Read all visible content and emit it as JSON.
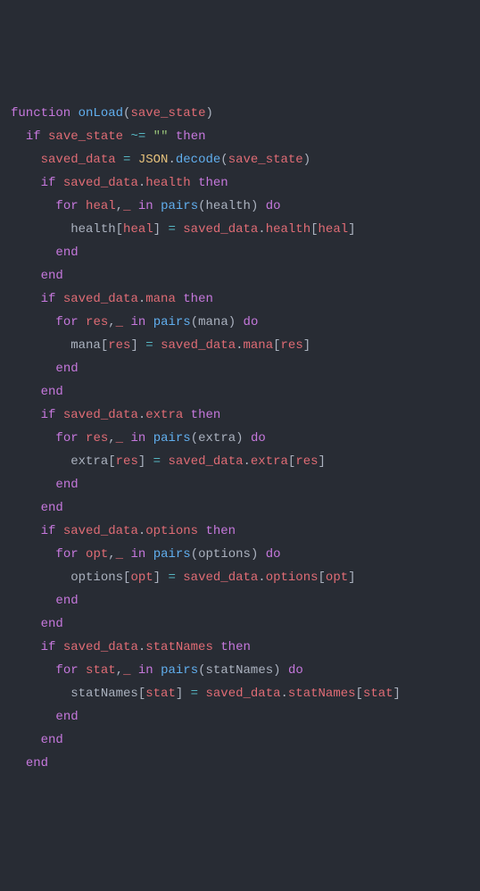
{
  "code": {
    "lines": [
      {
        "indent": 0,
        "tokens": [
          [
            "kw",
            "function"
          ],
          [
            "plain",
            " "
          ],
          [
            "fn",
            "onLoad"
          ],
          [
            "plain",
            "("
          ],
          [
            "id",
            "save_state"
          ],
          [
            "plain",
            ")"
          ]
        ]
      },
      {
        "indent": 1,
        "tokens": [
          [
            "kw",
            "if"
          ],
          [
            "plain",
            " "
          ],
          [
            "id",
            "save_state"
          ],
          [
            "plain",
            " "
          ],
          [
            "op",
            "~="
          ],
          [
            "plain",
            " "
          ],
          [
            "str",
            "\"\""
          ],
          [
            "plain",
            " "
          ],
          [
            "kw",
            "then"
          ]
        ]
      },
      {
        "indent": 2,
        "tokens": [
          [
            "id",
            "saved_data"
          ],
          [
            "plain",
            " "
          ],
          [
            "op",
            "="
          ],
          [
            "plain",
            " "
          ],
          [
            "cls",
            "JSON"
          ],
          [
            "plain",
            "."
          ],
          [
            "meth",
            "decode"
          ],
          [
            "plain",
            "("
          ],
          [
            "id",
            "save_state"
          ],
          [
            "plain",
            ")"
          ]
        ]
      },
      {
        "indent": 2,
        "tokens": [
          [
            "kw",
            "if"
          ],
          [
            "plain",
            " "
          ],
          [
            "id",
            "saved_data"
          ],
          [
            "plain",
            "."
          ],
          [
            "prop",
            "health"
          ],
          [
            "plain",
            " "
          ],
          [
            "kw",
            "then"
          ]
        ]
      },
      {
        "indent": 3,
        "tokens": [
          [
            "kw",
            "for"
          ],
          [
            "plain",
            " "
          ],
          [
            "id",
            "heal"
          ],
          [
            "plain",
            ","
          ],
          [
            "id",
            "_"
          ],
          [
            "plain",
            " "
          ],
          [
            "kw",
            "in"
          ],
          [
            "plain",
            " "
          ],
          [
            "fn",
            "pairs"
          ],
          [
            "plain",
            "("
          ],
          [
            "plain",
            "health"
          ],
          [
            "plain",
            ") "
          ],
          [
            "kw",
            "do"
          ]
        ]
      },
      {
        "indent": 4,
        "tokens": [
          [
            "plain",
            "health"
          ],
          [
            "plain",
            "["
          ],
          [
            "id",
            "heal"
          ],
          [
            "plain",
            "] "
          ],
          [
            "op",
            "="
          ],
          [
            "plain",
            " "
          ],
          [
            "id",
            "saved_data"
          ],
          [
            "plain",
            "."
          ],
          [
            "prop",
            "health"
          ],
          [
            "plain",
            "["
          ],
          [
            "id",
            "heal"
          ],
          [
            "plain",
            "]"
          ]
        ]
      },
      {
        "indent": 3,
        "tokens": [
          [
            "kw",
            "end"
          ]
        ]
      },
      {
        "indent": 2,
        "tokens": [
          [
            "kw",
            "end"
          ]
        ]
      },
      {
        "indent": 2,
        "tokens": [
          [
            "kw",
            "if"
          ],
          [
            "plain",
            " "
          ],
          [
            "id",
            "saved_data"
          ],
          [
            "plain",
            "."
          ],
          [
            "prop",
            "mana"
          ],
          [
            "plain",
            " "
          ],
          [
            "kw",
            "then"
          ]
        ]
      },
      {
        "indent": 3,
        "tokens": [
          [
            "kw",
            "for"
          ],
          [
            "plain",
            " "
          ],
          [
            "id",
            "res"
          ],
          [
            "plain",
            ","
          ],
          [
            "id",
            "_"
          ],
          [
            "plain",
            " "
          ],
          [
            "kw",
            "in"
          ],
          [
            "plain",
            " "
          ],
          [
            "fn",
            "pairs"
          ],
          [
            "plain",
            "("
          ],
          [
            "plain",
            "mana"
          ],
          [
            "plain",
            ") "
          ],
          [
            "kw",
            "do"
          ]
        ]
      },
      {
        "indent": 4,
        "tokens": [
          [
            "plain",
            "mana"
          ],
          [
            "plain",
            "["
          ],
          [
            "id",
            "res"
          ],
          [
            "plain",
            "] "
          ],
          [
            "op",
            "="
          ],
          [
            "plain",
            " "
          ],
          [
            "id",
            "saved_data"
          ],
          [
            "plain",
            "."
          ],
          [
            "prop",
            "mana"
          ],
          [
            "plain",
            "["
          ],
          [
            "id",
            "res"
          ],
          [
            "plain",
            "]"
          ]
        ]
      },
      {
        "indent": 3,
        "tokens": [
          [
            "kw",
            "end"
          ]
        ]
      },
      {
        "indent": 2,
        "tokens": [
          [
            "kw",
            "end"
          ]
        ]
      },
      {
        "indent": 2,
        "tokens": [
          [
            "kw",
            "if"
          ],
          [
            "plain",
            " "
          ],
          [
            "id",
            "saved_data"
          ],
          [
            "plain",
            "."
          ],
          [
            "prop",
            "extra"
          ],
          [
            "plain",
            " "
          ],
          [
            "kw",
            "then"
          ]
        ]
      },
      {
        "indent": 3,
        "tokens": [
          [
            "kw",
            "for"
          ],
          [
            "plain",
            " "
          ],
          [
            "id",
            "res"
          ],
          [
            "plain",
            ","
          ],
          [
            "id",
            "_"
          ],
          [
            "plain",
            " "
          ],
          [
            "kw",
            "in"
          ],
          [
            "plain",
            " "
          ],
          [
            "fn",
            "pairs"
          ],
          [
            "plain",
            "("
          ],
          [
            "plain",
            "extra"
          ],
          [
            "plain",
            ") "
          ],
          [
            "kw",
            "do"
          ]
        ]
      },
      {
        "indent": 4,
        "tokens": [
          [
            "plain",
            "extra"
          ],
          [
            "plain",
            "["
          ],
          [
            "id",
            "res"
          ],
          [
            "plain",
            "] "
          ],
          [
            "op",
            "="
          ],
          [
            "plain",
            " "
          ],
          [
            "id",
            "saved_data"
          ],
          [
            "plain",
            "."
          ],
          [
            "prop",
            "extra"
          ],
          [
            "plain",
            "["
          ],
          [
            "id",
            "res"
          ],
          [
            "plain",
            "]"
          ]
        ]
      },
      {
        "indent": 3,
        "tokens": [
          [
            "kw",
            "end"
          ]
        ]
      },
      {
        "indent": 2,
        "tokens": [
          [
            "kw",
            "end"
          ]
        ]
      },
      {
        "indent": 2,
        "tokens": [
          [
            "kw",
            "if"
          ],
          [
            "plain",
            " "
          ],
          [
            "id",
            "saved_data"
          ],
          [
            "plain",
            "."
          ],
          [
            "prop",
            "options"
          ],
          [
            "plain",
            " "
          ],
          [
            "kw",
            "then"
          ]
        ]
      },
      {
        "indent": 3,
        "tokens": [
          [
            "kw",
            "for"
          ],
          [
            "plain",
            " "
          ],
          [
            "id",
            "opt"
          ],
          [
            "plain",
            ","
          ],
          [
            "id",
            "_"
          ],
          [
            "plain",
            " "
          ],
          [
            "kw",
            "in"
          ],
          [
            "plain",
            " "
          ],
          [
            "fn",
            "pairs"
          ],
          [
            "plain",
            "("
          ],
          [
            "plain",
            "options"
          ],
          [
            "plain",
            ") "
          ],
          [
            "kw",
            "do"
          ]
        ]
      },
      {
        "indent": 4,
        "tokens": [
          [
            "plain",
            "options"
          ],
          [
            "plain",
            "["
          ],
          [
            "id",
            "opt"
          ],
          [
            "plain",
            "] "
          ],
          [
            "op",
            "="
          ],
          [
            "plain",
            " "
          ],
          [
            "id",
            "saved_data"
          ],
          [
            "plain",
            "."
          ],
          [
            "prop",
            "options"
          ],
          [
            "plain",
            "["
          ],
          [
            "id",
            "opt"
          ],
          [
            "plain",
            "]"
          ]
        ]
      },
      {
        "indent": 3,
        "tokens": [
          [
            "kw",
            "end"
          ]
        ]
      },
      {
        "indent": 2,
        "tokens": [
          [
            "kw",
            "end"
          ]
        ]
      },
      {
        "indent": 2,
        "tokens": [
          [
            "kw",
            "if"
          ],
          [
            "plain",
            " "
          ],
          [
            "id",
            "saved_data"
          ],
          [
            "plain",
            "."
          ],
          [
            "prop",
            "statNames"
          ],
          [
            "plain",
            " "
          ],
          [
            "kw",
            "then"
          ]
        ]
      },
      {
        "indent": 3,
        "tokens": [
          [
            "kw",
            "for"
          ],
          [
            "plain",
            " "
          ],
          [
            "id",
            "stat"
          ],
          [
            "plain",
            ","
          ],
          [
            "id",
            "_"
          ],
          [
            "plain",
            " "
          ],
          [
            "kw",
            "in"
          ],
          [
            "plain",
            " "
          ],
          [
            "fn",
            "pairs"
          ],
          [
            "plain",
            "("
          ],
          [
            "plain",
            "statNames"
          ],
          [
            "plain",
            ") "
          ],
          [
            "kw",
            "do"
          ]
        ]
      },
      {
        "indent": 4,
        "tokens": [
          [
            "plain",
            "statNames"
          ],
          [
            "plain",
            "["
          ],
          [
            "id",
            "stat"
          ],
          [
            "plain",
            "] "
          ],
          [
            "op",
            "="
          ],
          [
            "plain",
            " "
          ],
          [
            "id",
            "saved_data"
          ],
          [
            "plain",
            "."
          ],
          [
            "prop",
            "statNames"
          ],
          [
            "plain",
            "["
          ],
          [
            "id",
            "stat"
          ],
          [
            "plain",
            "]"
          ]
        ]
      },
      {
        "indent": 3,
        "tokens": [
          [
            "kw",
            "end"
          ]
        ]
      },
      {
        "indent": 2,
        "tokens": [
          [
            "kw",
            "end"
          ]
        ]
      },
      {
        "indent": 1,
        "tokens": [
          [
            "kw",
            "end"
          ]
        ]
      }
    ],
    "indent_unit": "  "
  }
}
